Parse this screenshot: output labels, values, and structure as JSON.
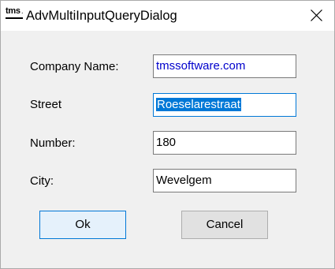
{
  "window": {
    "title": "AdvMultiInputQueryDialog",
    "icon": "tms-logo-icon",
    "icon_text": "tms",
    "close_icon": "close-icon"
  },
  "fields": [
    {
      "label": "Company Name:",
      "value": "tmssoftware.com"
    },
    {
      "label": "Street",
      "value": "Roeselarestraat"
    },
    {
      "label": "Number:",
      "value": "180"
    },
    {
      "label": "City:",
      "value": "Wevelgem"
    }
  ],
  "buttons": {
    "ok_label": "Ok",
    "cancel_label": "Cancel"
  },
  "colors": {
    "link_text": "#0000cc",
    "selection": "#0078d7",
    "focus_border": "#0078d7",
    "default_button_bg": "#e5f1fb"
  }
}
